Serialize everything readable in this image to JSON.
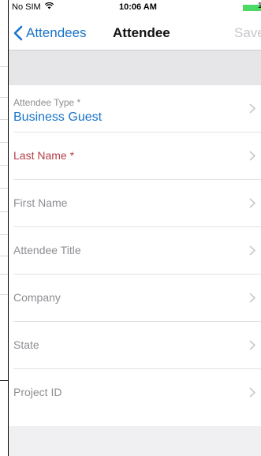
{
  "status_bar": {
    "carrier": "No SIM",
    "time": "10:06 AM",
    "battery_label": "1"
  },
  "nav": {
    "back_label": "Attendees",
    "title": "Attendee",
    "save_label": "Save"
  },
  "fields": [
    {
      "label": "Attendee Type *",
      "value": "Business Guest",
      "required": false
    },
    {
      "label": "Last Name *",
      "value": "",
      "required": true
    },
    {
      "label": "First Name",
      "value": "",
      "required": false
    },
    {
      "label": "Attendee Title",
      "value": "",
      "required": false
    },
    {
      "label": "Company",
      "value": "",
      "required": false
    },
    {
      "label": "State",
      "value": "",
      "required": false
    },
    {
      "label": "Project ID",
      "value": "",
      "required": false
    }
  ],
  "colors": {
    "accent": "#1a73c9",
    "required": "#b33f47",
    "battery": "#4cd964"
  }
}
